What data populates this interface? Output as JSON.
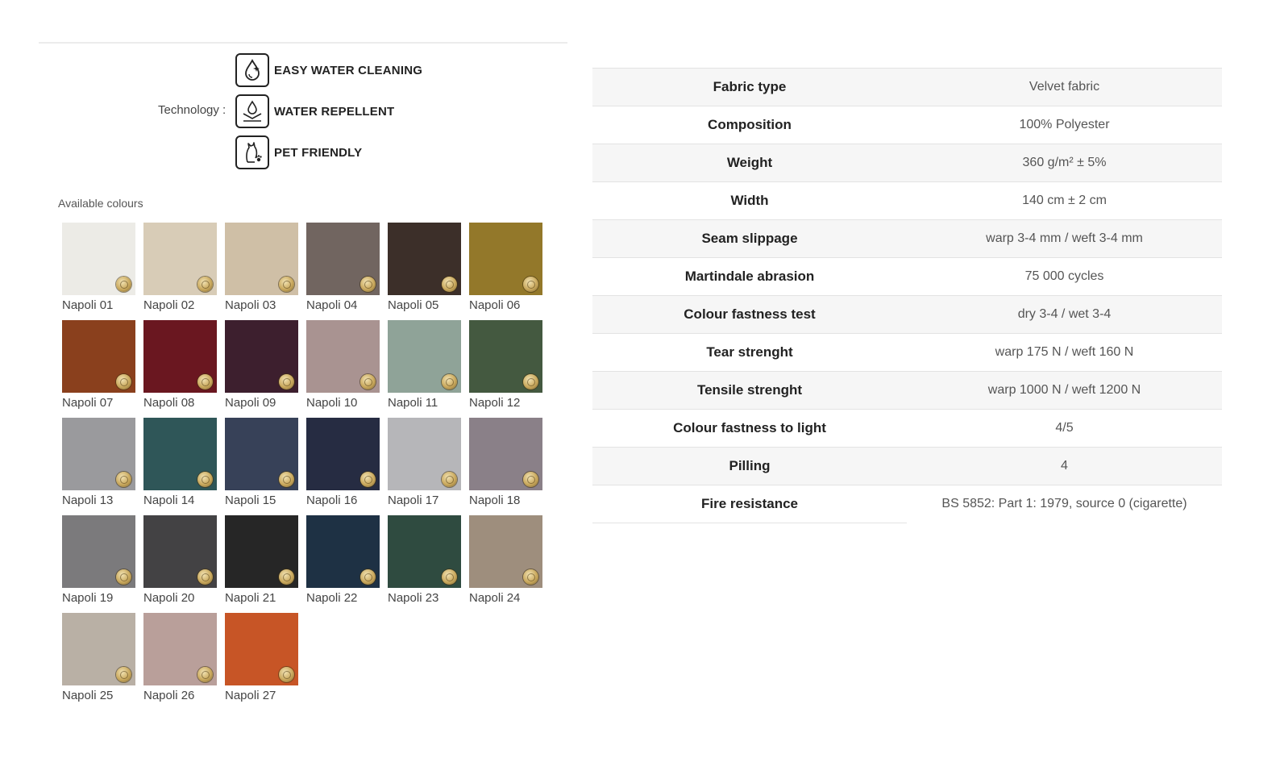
{
  "technology": {
    "label": "Technology :",
    "items": [
      {
        "name": "EASY WATER CLEANING",
        "icon": "water-drop-sparkle-icon"
      },
      {
        "name": "WATER REPELLENT",
        "icon": "water-repellent-icon"
      },
      {
        "name": "PET FRIENDLY",
        "icon": "pet-friendly-icon"
      }
    ]
  },
  "colours": {
    "title": "Available colours",
    "items": [
      {
        "name": "Napoli 01",
        "color": "#ecebe6"
      },
      {
        "name": "Napoli 02",
        "color": "#d8ccb7"
      },
      {
        "name": "Napoli 03",
        "color": "#cfbfa6"
      },
      {
        "name": "Napoli 04",
        "color": "#716560"
      },
      {
        "name": "Napoli 05",
        "color": "#3c2f29"
      },
      {
        "name": "Napoli 06",
        "color": "#93782a"
      },
      {
        "name": "Napoli 07",
        "color": "#8a401d"
      },
      {
        "name": "Napoli 08",
        "color": "#6a1720"
      },
      {
        "name": "Napoli 09",
        "color": "#3d1f2e"
      },
      {
        "name": "Napoli 10",
        "color": "#a99391"
      },
      {
        "name": "Napoli 11",
        "color": "#8fa398"
      },
      {
        "name": "Napoli 12",
        "color": "#445940"
      },
      {
        "name": "Napoli 13",
        "color": "#9a9a9d"
      },
      {
        "name": "Napoli 14",
        "color": "#2f5658"
      },
      {
        "name": "Napoli 15",
        "color": "#374158"
      },
      {
        "name": "Napoli 16",
        "color": "#262c42"
      },
      {
        "name": "Napoli 17",
        "color": "#b6b6b9"
      },
      {
        "name": "Napoli 18",
        "color": "#8a8088"
      },
      {
        "name": "Napoli 19",
        "color": "#7b7a7c"
      },
      {
        "name": "Napoli 20",
        "color": "#434244"
      },
      {
        "name": "Napoli 21",
        "color": "#262626"
      },
      {
        "name": "Napoli 22",
        "color": "#1e3144"
      },
      {
        "name": "Napoli 23",
        "color": "#2f4b40"
      },
      {
        "name": "Napoli 24",
        "color": "#9e8e7d"
      },
      {
        "name": "Napoli 25",
        "color": "#b9b0a5"
      },
      {
        "name": "Napoli 26",
        "color": "#b99f9a"
      },
      {
        "name": "Napoli 27",
        "color": "#c75526"
      }
    ]
  },
  "specs": [
    {
      "key": "Fabric type",
      "value": "Velvet fabric"
    },
    {
      "key": "Composition",
      "value": "100% Polyester"
    },
    {
      "key": "Weight",
      "value": "360 g/m² ± 5%"
    },
    {
      "key": "Width",
      "value": "140 cm ± 2 cm"
    },
    {
      "key": "Seam slippage",
      "value": "warp 3-4 mm / weft 3-4 mm"
    },
    {
      "key": "Martindale abrasion",
      "value": "75 000 cycles"
    },
    {
      "key": "Colour fastness test",
      "value": "dry 3-4 / wet 3-4"
    },
    {
      "key": "Tear strenght",
      "value": "warp 175 N / weft 160 N"
    },
    {
      "key": "Tensile strenght",
      "value": "warp 1000 N / weft 1200 N"
    },
    {
      "key": "Colour fastness to light",
      "value": "4/5"
    },
    {
      "key": "Pilling",
      "value": "4"
    },
    {
      "key": "Fire resistance",
      "value": "BS 5852: Part 1: 1979, source 0 (cigarette)"
    }
  ]
}
